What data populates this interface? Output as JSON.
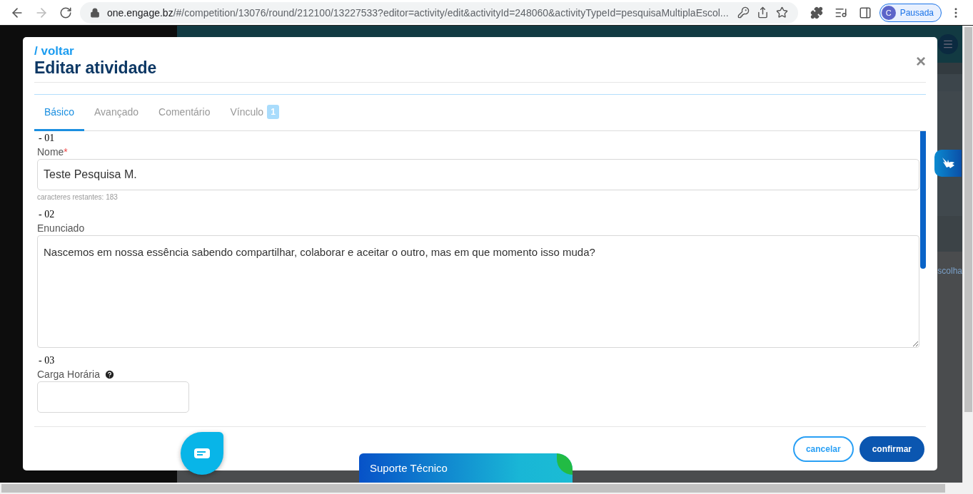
{
  "browser": {
    "url_host": "one.engage.bz",
    "url_path": "/#/competition/13076/round/212100/13227533?editor=activity/edit&activityId=248060&activityTypeId=pesquisaMultiplaEscol...",
    "profile_initial": "C",
    "profile_label": "Pausada"
  },
  "background_page": {
    "text": "scolha"
  },
  "modal": {
    "back_link": "/ voltar",
    "title": "Editar atividade",
    "close": "×",
    "tabs": [
      {
        "label": "Básico",
        "selected": true
      },
      {
        "label": "Avançado",
        "selected": false
      },
      {
        "label": "Comentário",
        "selected": false
      },
      {
        "label": "Vínculo",
        "selected": false,
        "badge": "1"
      }
    ],
    "fields": [
      {
        "kind": "text",
        "number": "- 01",
        "label": "Nome",
        "required_mark": "*",
        "help": false,
        "value": "Teste Pesquisa M.",
        "hint": "caracteres restantes: 183"
      },
      {
        "kind": "textarea",
        "number": "- 02",
        "label": "Enunciado",
        "help": false,
        "value": "Nascemos em nossa essência sabendo compartilhar, colaborar e aceitar o outro, mas em que momento isso muda?"
      },
      {
        "kind": "short",
        "number": "- 03",
        "label": "Carga Horária",
        "help": true
      }
    ],
    "buttons": [
      {
        "kind": "outline",
        "label": "cancelar"
      },
      {
        "kind": "primary",
        "label": "confirmar"
      }
    ]
  },
  "support_widget": {
    "label": "Suporte Técnico"
  }
}
